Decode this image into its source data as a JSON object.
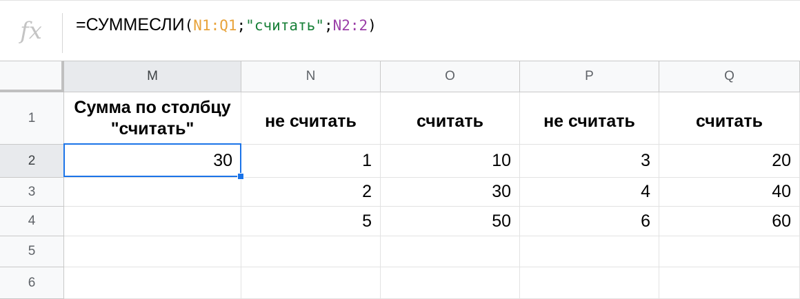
{
  "formula_bar": {
    "fx_label": "fx",
    "formula": {
      "prefix": "=СУММЕСЛИ",
      "open_paren": "(",
      "range": "N1:Q1",
      "sep1": ";",
      "criterion": "\"считать\"",
      "sep2": ";",
      "sum_range": "N2:2",
      "close_paren": ")"
    }
  },
  "columns": [
    "M",
    "N",
    "O",
    "P",
    "Q"
  ],
  "rows": [
    "1",
    "2",
    "3",
    "4",
    "5",
    "6"
  ],
  "cells": {
    "M1": "Сумма по столбцу \"считать\"",
    "N1": "не считать",
    "O1": "считать",
    "P1": "не считать",
    "Q1": "считать",
    "M2": "30",
    "N2": "1",
    "O2": "10",
    "P2": "3",
    "Q2": "20",
    "N3": "2",
    "O3": "30",
    "P3": "4",
    "Q3": "40",
    "N4": "5",
    "O4": "50",
    "P4": "6",
    "Q4": "60",
    "M3": "",
    "M4": "",
    "M5": "",
    "M6": "",
    "N5": "",
    "O5": "",
    "P5": "",
    "Q5": "",
    "N6": "",
    "O6": "",
    "P6": "",
    "Q6": ""
  },
  "selection": {
    "active_cell": "M2",
    "active_column": "M",
    "active_row": "2",
    "color": "#1a73e8"
  },
  "colors": {
    "range_ref": "#e8a33a",
    "string_literal": "#188038",
    "sum_range_ref": "#9b3fa8",
    "header_bg": "#f8f9fa",
    "active_header_bg": "#e8eaed"
  }
}
